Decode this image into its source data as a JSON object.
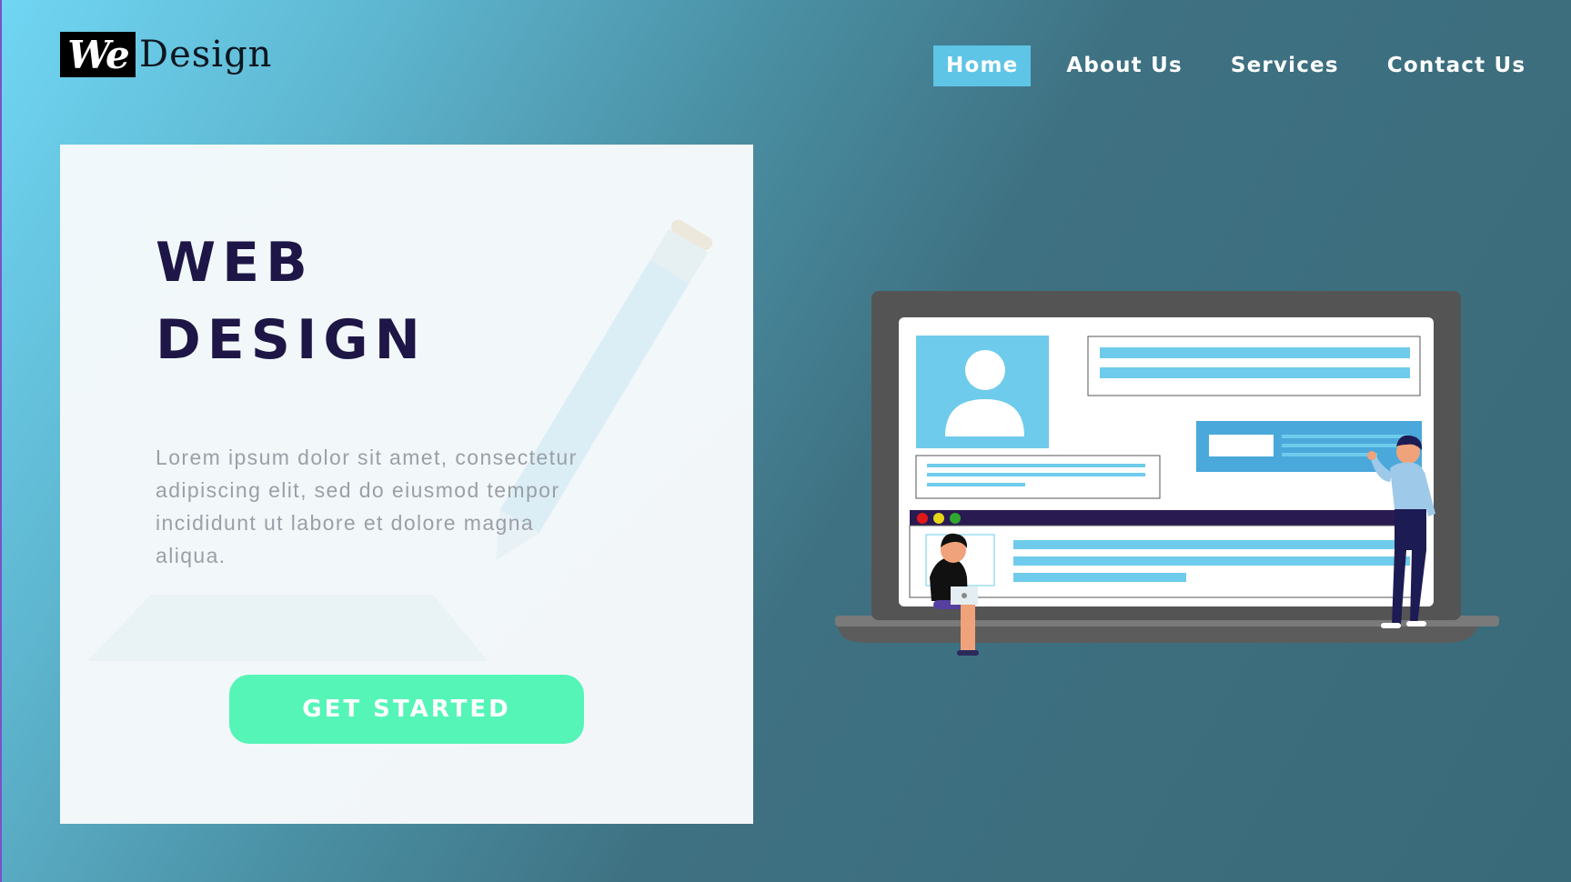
{
  "brand": {
    "logo_mark": "We",
    "logo_word": "Design"
  },
  "nav": {
    "items": [
      {
        "label": "Home",
        "active": true
      },
      {
        "label": "About Us",
        "active": false
      },
      {
        "label": "Services",
        "active": false
      },
      {
        "label": "Contact Us",
        "active": false
      }
    ]
  },
  "hero": {
    "title_line1": "WEB",
    "title_line2": "DESIGN",
    "body_lines": [
      "Lorem ipsum dolor sit amet, consectetur",
      "adipiscing elit, sed do eiusmod tempor",
      "incididunt ut labore et dolore magna",
      "aliqua."
    ],
    "cta_label": "GET STARTED"
  },
  "colors": {
    "accent": "#55f5b7",
    "nav_active": "#5ec5e6",
    "title": "#1e1646",
    "bg_start": "#70d6f3",
    "bg_end": "#396a79"
  },
  "icons": [
    "pencil-watermark-icon",
    "laptop-illustration",
    "user-avatar-icon"
  ]
}
